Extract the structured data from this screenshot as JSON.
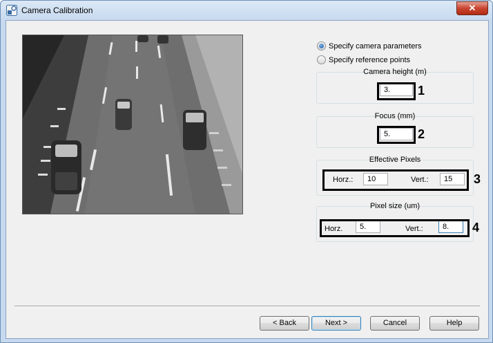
{
  "window": {
    "title": "Camera Calibration"
  },
  "mode": {
    "options": [
      {
        "label": "Specify camera parameters",
        "checked": true
      },
      {
        "label": "Specify reference points",
        "checked": false
      }
    ]
  },
  "camera_height": {
    "title": "Camera height (m)",
    "value": "3."
  },
  "focus": {
    "title": "Focus (mm)",
    "value": "5."
  },
  "effective_pixels": {
    "title": "Effective Pixels",
    "horz_label": "Horz.:",
    "horz_value": "10",
    "vert_label": "Vert.:",
    "vert_value": "15"
  },
  "pixel_size": {
    "title": "Pixel size (um)",
    "horz_label": "Horz.",
    "horz_value": "5.",
    "vert_label": "Vert.:",
    "vert_value": "8."
  },
  "callouts": [
    "1",
    "2",
    "3",
    "4"
  ],
  "buttons": {
    "back": "< Back",
    "next": "Next >",
    "cancel": "Cancel",
    "help": "Help"
  },
  "icons": {
    "app": "camera-calibration-app-icon",
    "close": "close-icon"
  }
}
